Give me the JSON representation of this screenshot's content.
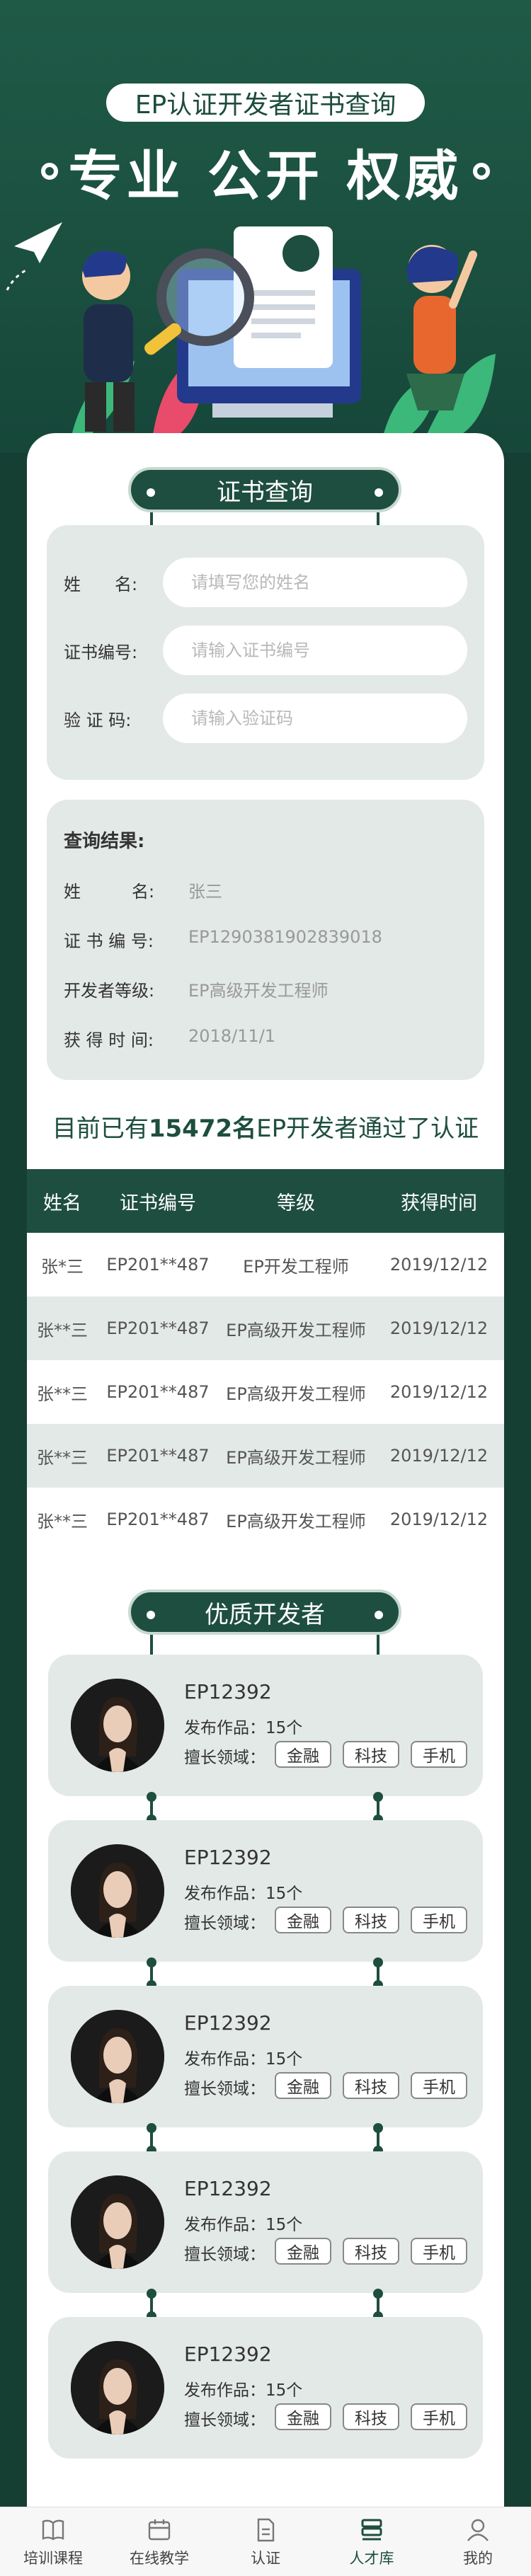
{
  "hero": {
    "pill": "EP认证开发者证书查询",
    "title": "专业 公开 权威"
  },
  "query": {
    "title": "证书查询",
    "fields": [
      {
        "label": "姓　　名:",
        "placeholder": "请填写您的姓名"
      },
      {
        "label": "证书编号:",
        "placeholder": "请输入证书编号"
      },
      {
        "label": "验 证 码:",
        "placeholder": "请输入验证码"
      }
    ]
  },
  "result": {
    "title": "查询结果:",
    "rows": [
      {
        "label": "姓　　　名:",
        "value": "张三"
      },
      {
        "label": "证 书 编 号:",
        "value": "EP1290381902839018"
      },
      {
        "label": "开发者等级:",
        "value": "EP高级开发工程师"
      },
      {
        "label": "获 得 时 间:",
        "value": "2018/11/1"
      }
    ]
  },
  "stat": {
    "prefix": "目前已有",
    "count": "15472名",
    "suffix": "EP开发者通过了认证"
  },
  "table": {
    "headers": [
      "姓名",
      "证书编号",
      "等级",
      "获得时间"
    ],
    "rows": [
      [
        "张*三",
        "EP201**487",
        "EP开发工程师",
        "2019/12/12"
      ],
      [
        "张**三",
        "EP201**487",
        "EP高级开发工程师",
        "2019/12/12"
      ],
      [
        "张**三",
        "EP201**487",
        "EP高级开发工程师",
        "2019/12/12"
      ],
      [
        "张**三",
        "EP201**487",
        "EP高级开发工程师",
        "2019/12/12"
      ],
      [
        "张**三",
        "EP201**487",
        "EP高级开发工程师",
        "2019/12/12"
      ]
    ]
  },
  "developers": {
    "title": "优质开发者",
    "items": [
      {
        "id": "EP12392",
        "works": "发布作品：15个",
        "field_label": "擅长领域：",
        "tags": [
          "金融",
          "科技",
          "手机"
        ]
      },
      {
        "id": "EP12392",
        "works": "发布作品：15个",
        "field_label": "擅长领域：",
        "tags": [
          "金融",
          "科技",
          "手机"
        ]
      },
      {
        "id": "EP12392",
        "works": "发布作品：15个",
        "field_label": "擅长领域：",
        "tags": [
          "金融",
          "科技",
          "手机"
        ]
      },
      {
        "id": "EP12392",
        "works": "发布作品：15个",
        "field_label": "擅长领域：",
        "tags": [
          "金融",
          "科技",
          "手机"
        ]
      },
      {
        "id": "EP12392",
        "works": "发布作品：15个",
        "field_label": "擅长领域：",
        "tags": [
          "金融",
          "科技",
          "手机"
        ]
      }
    ]
  },
  "tabbar": [
    {
      "label": "培训课程",
      "icon": "book-icon"
    },
    {
      "label": "在线教学",
      "icon": "calendar-icon"
    },
    {
      "label": "认证",
      "icon": "document-icon"
    },
    {
      "label": "人才库",
      "icon": "database-icon"
    },
    {
      "label": "我的",
      "icon": "user-icon"
    }
  ],
  "colors": {
    "brand": "#1e4e3f",
    "panel": "#e3e9e6",
    "hero_bg": "#1f5a47"
  }
}
